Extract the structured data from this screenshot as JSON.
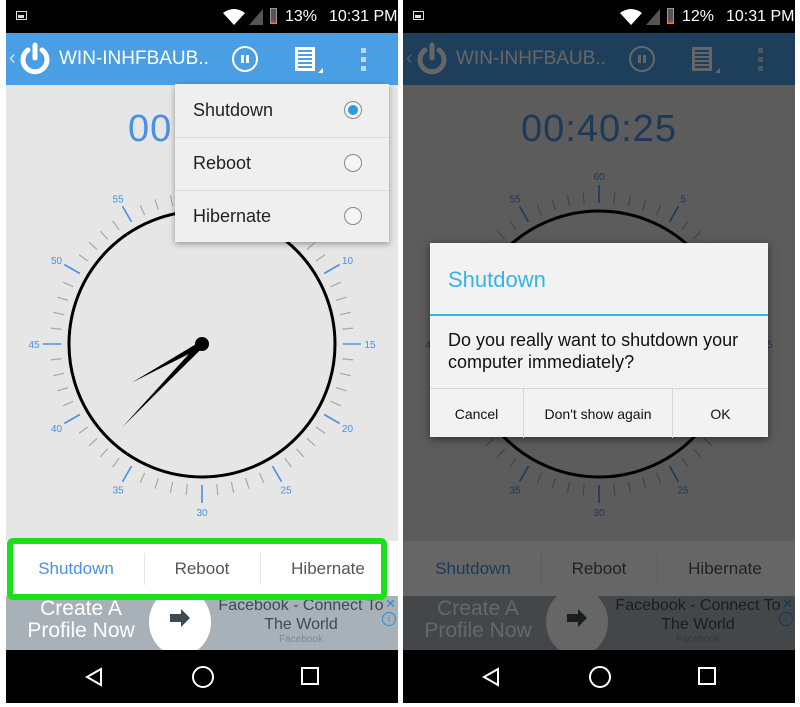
{
  "colors": {
    "accent": "#4a9fe4",
    "timer_blue": "#4a90e2",
    "dialog_accent": "#33b5e5",
    "highlight_frame": "#19e019",
    "battery_low": "#e53a1a"
  },
  "screens": [
    {
      "status_bar": {
        "battery": "13%",
        "time": "10:31 PM"
      },
      "app_bar": {
        "title": "WIN-INHFBAUB.."
      },
      "timer": "00:",
      "dropdown": {
        "items": [
          {
            "label": "Shutdown",
            "selected": true
          },
          {
            "label": "Reboot",
            "selected": false
          },
          {
            "label": "Hibernate",
            "selected": false
          }
        ]
      },
      "bottom_tabs": [
        {
          "label": "Shutdown",
          "active": true
        },
        {
          "label": "Reboot",
          "active": false
        },
        {
          "label": "Hibernate",
          "active": false
        }
      ],
      "ad": {
        "cta": "Create A Profile Now",
        "title": "Facebook - Connect To The World",
        "source": "Facebook",
        "close": "✕",
        "info": "i"
      }
    },
    {
      "status_bar": {
        "battery": "12%",
        "time": "10:31 PM"
      },
      "app_bar": {
        "title": "WIN-INHFBAUB.."
      },
      "timer": "00:40:25",
      "dialog": {
        "title": "Shutdown",
        "message": "Do you really want to shutdown your computer immediately?",
        "buttons": [
          "Cancel",
          "Don't show again",
          "OK"
        ]
      },
      "bottom_tabs": [
        {
          "label": "Shutdown",
          "active": true
        },
        {
          "label": "Reboot",
          "active": false
        },
        {
          "label": "Hibernate",
          "active": false
        }
      ],
      "ad": {
        "cta": "Create A Profile Now",
        "title": "Facebook - Connect To The World",
        "source": "Facebook",
        "close": "✕",
        "info": "i"
      }
    }
  ],
  "dial": {
    "labels": [
      "60",
      "5",
      "10",
      "15",
      "20",
      "25",
      "30",
      "35",
      "40",
      "45",
      "50",
      "55"
    ],
    "hour_hand_minute_pos": 40.2,
    "minute_hand_minute_pos": 37.3
  },
  "nav_bar": {
    "icons": [
      "back-icon",
      "home-icon",
      "recents-icon"
    ]
  }
}
